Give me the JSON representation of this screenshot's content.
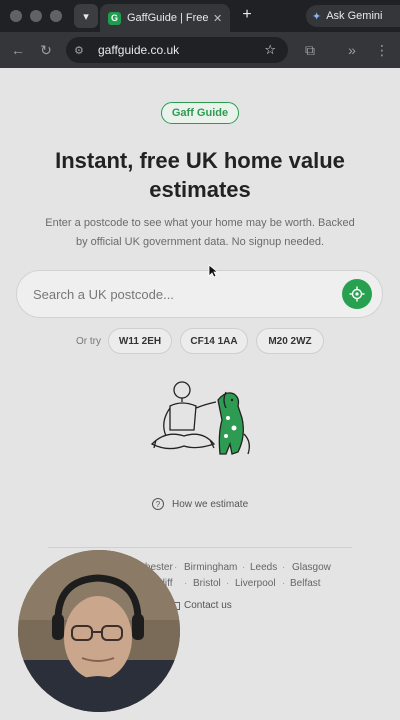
{
  "browser": {
    "tab": {
      "favicon_letter": "G",
      "title": "GaffGuide | Free",
      "close": "✕"
    },
    "new_tab": "+",
    "gemini_label": "Ask Gemini",
    "url": "gaffguide.co.uk"
  },
  "page": {
    "badge": "Gaff Guide",
    "headline_line1": "Instant, free UK home value",
    "headline_line2": "estimates",
    "subtext_line1": "Enter a postcode to see what your home may be worth. Backed",
    "subtext_line2": "by official UK government data. No signup needed.",
    "search_placeholder": "Search a UK postcode...",
    "or_try": "Or try",
    "chips": [
      "W11 2EH",
      "CF14 1AA",
      "M20 2WZ"
    ],
    "how_we_estimate": "How we estimate",
    "footer_cities_row1": [
      "chester",
      "Birmingham",
      "Leeds",
      "Glasgow"
    ],
    "footer_cities_row2": [
      "rdiff",
      "Bristol",
      "Liverpool",
      "Belfast"
    ],
    "contact": "Contact us"
  },
  "colors": {
    "accent_green": "#27a150",
    "chrome_dark": "#202124",
    "page_bg": "#e4e4e4"
  }
}
